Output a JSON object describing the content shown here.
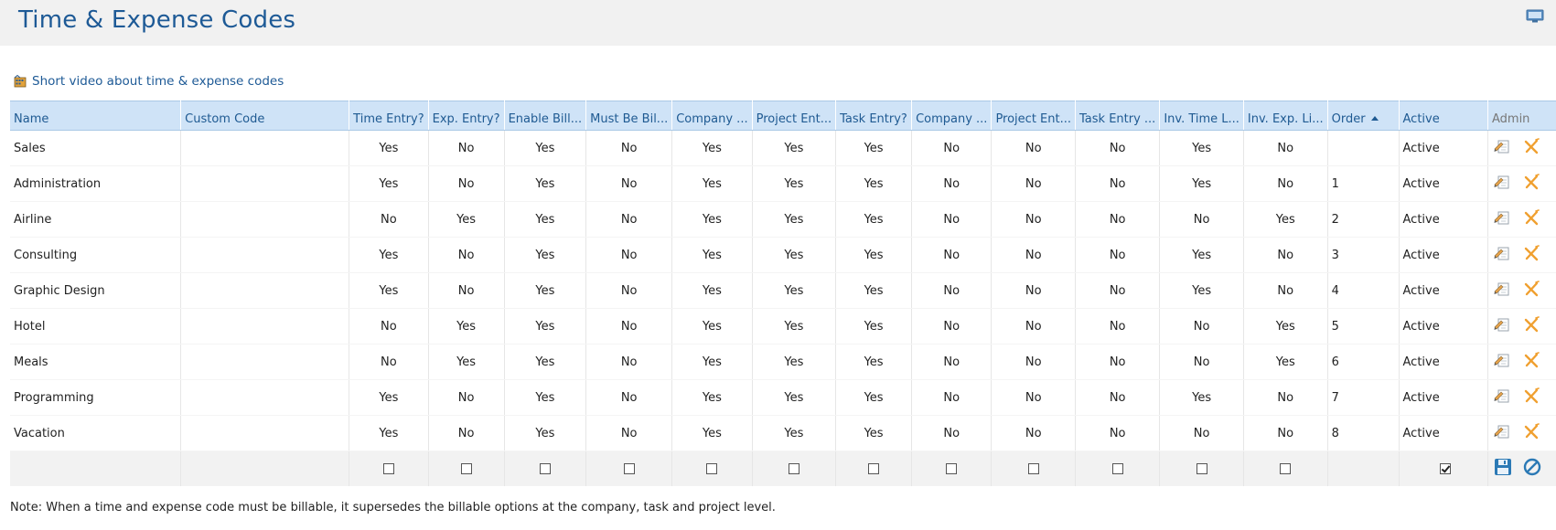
{
  "page": {
    "title": "Time & Expense Codes"
  },
  "video_link": {
    "label": "Short video about time & expense codes"
  },
  "table": {
    "headers": [
      "Name",
      "Custom Code",
      "Time Entry?",
      "Exp. Entry?",
      "Enable Bill...",
      "Must Be Bil...",
      "Company ...",
      "Project Ent...",
      "Task Entry?",
      "Company ...",
      "Project Ent...",
      "Task Entry ...",
      "Inv. Time L...",
      "Inv. Exp. Li...",
      "Order",
      "Active",
      "Admin"
    ],
    "sorted_column": "Order",
    "sort_direction": "ascending",
    "rows": [
      [
        "Sales",
        "",
        "Yes",
        "No",
        "Yes",
        "No",
        "Yes",
        "Yes",
        "Yes",
        "No",
        "No",
        "No",
        "Yes",
        "No",
        "",
        "Active"
      ],
      [
        "Administration",
        "",
        "Yes",
        "No",
        "Yes",
        "No",
        "Yes",
        "Yes",
        "Yes",
        "No",
        "No",
        "No",
        "Yes",
        "No",
        "1",
        "Active"
      ],
      [
        "Airline",
        "",
        "No",
        "Yes",
        "Yes",
        "No",
        "Yes",
        "Yes",
        "Yes",
        "No",
        "No",
        "No",
        "No",
        "Yes",
        "2",
        "Active"
      ],
      [
        "Consulting",
        "",
        "Yes",
        "No",
        "Yes",
        "No",
        "Yes",
        "Yes",
        "Yes",
        "No",
        "No",
        "No",
        "Yes",
        "No",
        "3",
        "Active"
      ],
      [
        "Graphic Design",
        "",
        "Yes",
        "No",
        "Yes",
        "No",
        "Yes",
        "Yes",
        "Yes",
        "No",
        "No",
        "No",
        "Yes",
        "No",
        "4",
        "Active"
      ],
      [
        "Hotel",
        "",
        "No",
        "Yes",
        "Yes",
        "No",
        "Yes",
        "Yes",
        "Yes",
        "No",
        "No",
        "No",
        "No",
        "Yes",
        "5",
        "Active"
      ],
      [
        "Meals",
        "",
        "No",
        "Yes",
        "Yes",
        "No",
        "Yes",
        "Yes",
        "Yes",
        "No",
        "No",
        "No",
        "No",
        "Yes",
        "6",
        "Active"
      ],
      [
        "Programming",
        "",
        "Yes",
        "No",
        "Yes",
        "No",
        "Yes",
        "Yes",
        "Yes",
        "No",
        "No",
        "No",
        "Yes",
        "No",
        "7",
        "Active"
      ],
      [
        "Vacation",
        "",
        "Yes",
        "No",
        "Yes",
        "No",
        "Yes",
        "Yes",
        "Yes",
        "No",
        "No",
        "No",
        "No",
        "No",
        "8",
        "Active"
      ]
    ],
    "new_row": {
      "checkboxes": [
        false,
        false,
        false,
        false,
        false,
        false,
        false,
        false,
        false,
        false,
        false,
        false
      ],
      "active_checked": true
    }
  },
  "note": "Note: When a time and expense code must be billable, it supersedes the billable options at the company, task and project level.",
  "icons": {
    "monitor": "monitor-icon",
    "video": "video-icon",
    "edit": "edit-icon",
    "delete": "delete-icon",
    "save": "save-icon",
    "cancel": "cancel-icon"
  },
  "colors": {
    "title": "#1e5a96",
    "header_bg": "#cfe3f7",
    "delete": "#f0a030",
    "save": "#2b79b5"
  }
}
